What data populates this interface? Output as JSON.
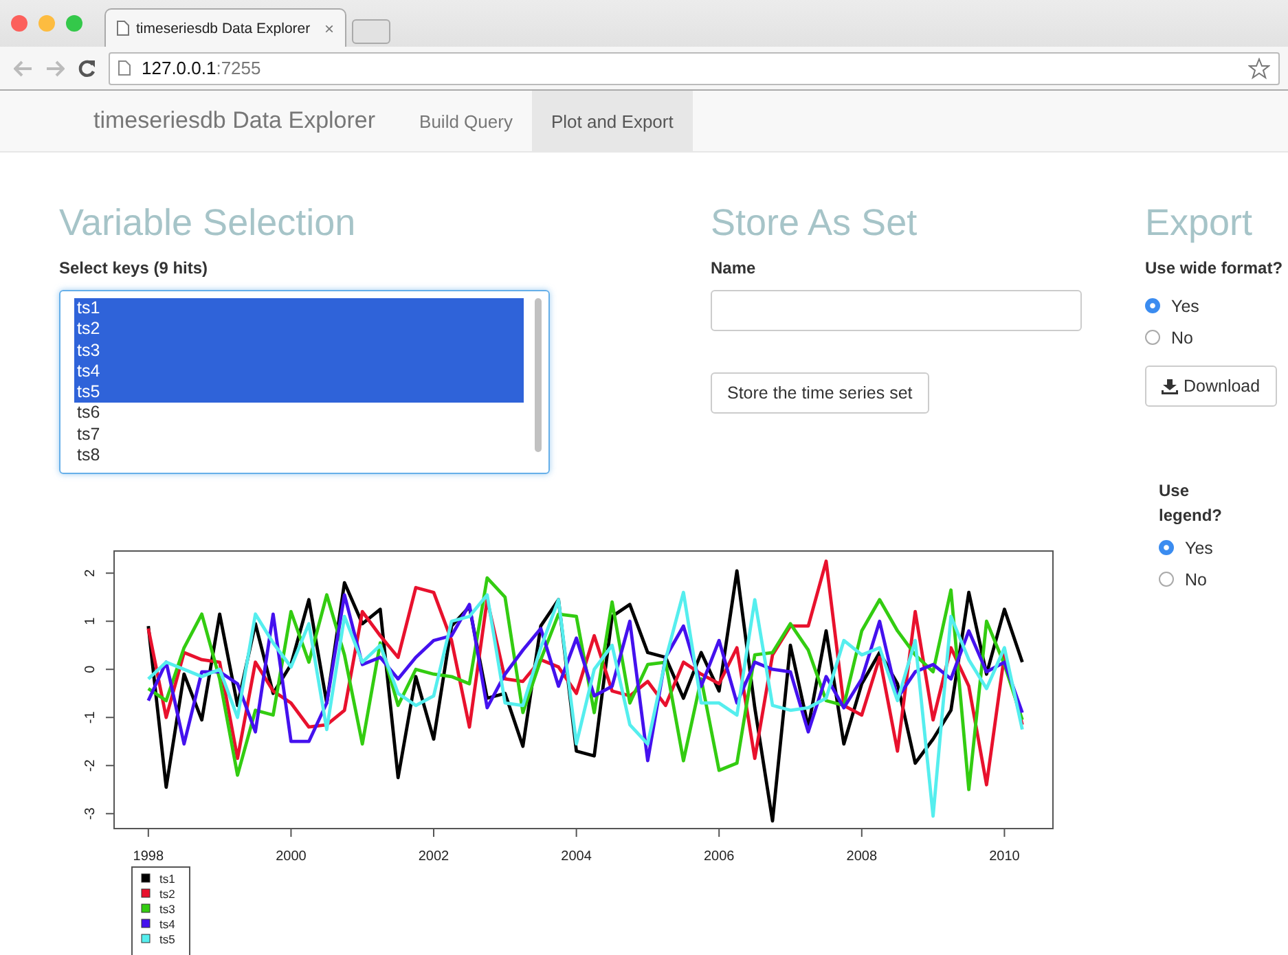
{
  "browser": {
    "tab_title": "timeseriesdb Data Explorer",
    "tab_close": "×",
    "url_host": "127.0.0.1",
    "url_port": ":7255"
  },
  "navbar": {
    "brand": "timeseriesdb Data Explorer",
    "items": [
      {
        "label": "Build Query",
        "selected": false
      },
      {
        "label": "Plot and Export",
        "selected": true
      }
    ]
  },
  "variable_selection": {
    "heading": "Variable Selection",
    "label": "Select keys (9 hits)",
    "options": [
      {
        "label": "ts1",
        "selected": true
      },
      {
        "label": "ts2",
        "selected": true
      },
      {
        "label": "ts3",
        "selected": true
      },
      {
        "label": "ts4",
        "selected": true
      },
      {
        "label": "ts5",
        "selected": true
      },
      {
        "label": "ts6",
        "selected": false
      },
      {
        "label": "ts7",
        "selected": false
      },
      {
        "label": "ts8",
        "selected": false
      }
    ]
  },
  "store": {
    "heading": "Store As Set",
    "name_label": "Name",
    "button": "Store the time series set"
  },
  "export": {
    "heading": "Export",
    "wide_label": "Use wide format?",
    "wide_options": [
      {
        "label": "Yes",
        "selected": true
      },
      {
        "label": "No",
        "selected": false
      }
    ],
    "download_button": "Download",
    "legend_label": "Use legend?",
    "legend_options": [
      {
        "label": "Yes",
        "selected": true
      },
      {
        "label": "No",
        "selected": false
      }
    ]
  },
  "plot": {
    "chart_data": {
      "type": "line",
      "x": [
        1998,
        1998.25,
        1998.5,
        1998.75,
        1999,
        1999.25,
        1999.5,
        1999.75,
        2000,
        2000.25,
        2000.5,
        2000.75,
        2001,
        2001.25,
        2001.5,
        2001.75,
        2002,
        2002.25,
        2002.5,
        2002.75,
        2003,
        2003.25,
        2003.5,
        2003.75,
        2004,
        2004.25,
        2004.5,
        2004.75,
        2005,
        2005.25,
        2005.5,
        2005.75,
        2006,
        2006.25,
        2006.5,
        2006.75,
        2007,
        2007.25,
        2007.5,
        2007.75,
        2008,
        2008.25,
        2008.5,
        2008.75,
        2009,
        2009.25,
        2009.5,
        2009.75,
        2010,
        2010.25
      ],
      "series": [
        {
          "name": "ts1",
          "color": "#000000",
          "values": [
            0.9,
            -2.45,
            -0.1,
            -1.05,
            1.15,
            -0.75,
            0.95,
            -0.5,
            0.1,
            1.45,
            -0.7,
            1.8,
            0.95,
            1.25,
            -2.25,
            -0.15,
            -1.45,
            0.9,
            1.3,
            -0.6,
            -0.5,
            -1.6,
            0.9,
            1.45,
            -1.7,
            -1.8,
            1.1,
            1.35,
            0.35,
            0.25,
            -0.6,
            0.35,
            -0.45,
            2.05,
            -0.8,
            -3.15,
            0.5,
            -1.2,
            0.8,
            -1.55,
            -0.3,
            0.35,
            -0.3,
            -1.95,
            -1.45,
            -0.85,
            1.6,
            -0.1,
            1.25,
            0.15
          ]
        },
        {
          "name": "ts2",
          "color": "#e8112d",
          "values": [
            0.85,
            -1.0,
            0.35,
            0.2,
            0.15,
            -1.85,
            0.15,
            -0.45,
            -0.7,
            -1.2,
            -1.15,
            -0.85,
            1.2,
            0.7,
            0.25,
            1.7,
            1.6,
            0.6,
            -1.2,
            1.45,
            -0.2,
            -0.25,
            0.2,
            0.05,
            -0.5,
            0.7,
            -0.45,
            -0.55,
            -0.25,
            -0.75,
            0.15,
            -0.1,
            -0.3,
            0.45,
            -1.85,
            0.3,
            0.9,
            0.9,
            2.25,
            -0.75,
            -0.95,
            0.25,
            -1.7,
            1.2,
            -1.05,
            0.45,
            -0.35,
            -2.4,
            0.3,
            -1.15
          ]
        },
        {
          "name": "ts3",
          "color": "#33cc11",
          "values": [
            -0.4,
            -0.65,
            0.45,
            1.15,
            -0.2,
            -2.2,
            -0.85,
            -0.95,
            1.2,
            0.15,
            1.55,
            0.3,
            -1.55,
            0.55,
            -0.75,
            0.0,
            -0.1,
            -0.15,
            -0.3,
            1.9,
            1.5,
            -0.9,
            0.2,
            1.15,
            1.1,
            -0.9,
            1.4,
            -0.7,
            0.1,
            0.15,
            -1.9,
            -0.2,
            -2.1,
            -1.95,
            0.3,
            0.35,
            0.95,
            0.4,
            -0.65,
            -0.75,
            0.8,
            1.45,
            0.8,
            0.3,
            -0.05,
            1.65,
            -2.5,
            1.0,
            0.1,
            -1.05
          ]
        },
        {
          "name": "ts4",
          "color": "#4411ee",
          "values": [
            -0.65,
            0.15,
            -1.55,
            -0.05,
            -0.05,
            -0.3,
            -1.3,
            1.15,
            -1.5,
            -1.5,
            -0.7,
            1.55,
            0.1,
            0.25,
            -0.2,
            0.25,
            0.6,
            0.7,
            1.35,
            -0.8,
            -0.1,
            0.4,
            0.85,
            -0.35,
            0.65,
            -0.55,
            -0.35,
            1.0,
            -1.9,
            0.25,
            0.9,
            -0.35,
            0.6,
            -0.7,
            0.15,
            0.0,
            -0.05,
            -1.3,
            -0.15,
            -0.8,
            -0.2,
            1.0,
            -0.6,
            -0.05,
            0.1,
            -0.2,
            0.8,
            -0.05,
            0.15,
            -0.9
          ]
        },
        {
          "name": "ts5",
          "color": "#55eeee",
          "values": [
            -0.2,
            0.15,
            0.0,
            -0.15,
            0.0,
            -1.0,
            1.15,
            0.55,
            0.05,
            0.95,
            -1.25,
            1.1,
            0.15,
            0.5,
            -0.5,
            -0.75,
            -0.55,
            1.0,
            1.1,
            1.55,
            -0.7,
            -0.75,
            0.45,
            1.45,
            -1.55,
            0.0,
            0.5,
            -1.15,
            -1.55,
            0.2,
            1.6,
            -0.7,
            -0.7,
            -0.95,
            1.45,
            -0.75,
            -0.85,
            -0.8,
            -0.6,
            0.6,
            0.3,
            0.45,
            -0.65,
            0.6,
            -3.05,
            1.1,
            0.2,
            -0.4,
            0.45,
            -1.25
          ]
        }
      ],
      "xlim": [
        1997.52,
        2010.68
      ],
      "ylim": [
        -3.31,
        2.46
      ],
      "legend": true,
      "xticks": [
        1998,
        2000,
        2002,
        2004,
        2006,
        2008,
        2010
      ],
      "yticks": [
        -3,
        -2,
        -1,
        0,
        1,
        2
      ]
    }
  }
}
